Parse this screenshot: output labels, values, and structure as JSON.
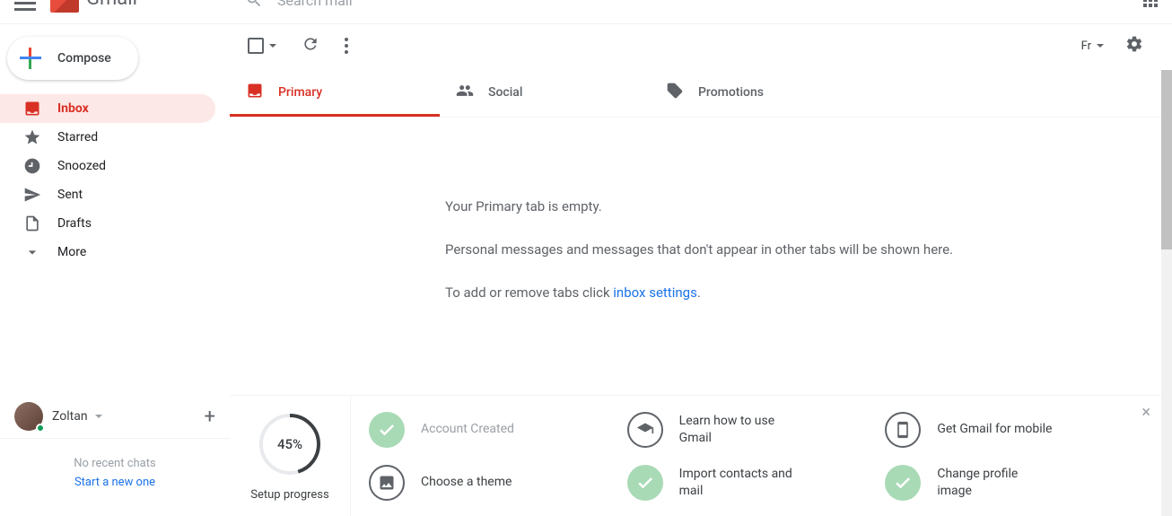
{
  "header": {
    "logo_text": "Gmail",
    "search_placeholder": "Search mail"
  },
  "sidebar": {
    "compose_label": "Compose",
    "items": [
      {
        "label": "Inbox",
        "icon": "inbox",
        "active": true
      },
      {
        "label": "Starred",
        "icon": "star"
      },
      {
        "label": "Snoozed",
        "icon": "clock"
      },
      {
        "label": "Sent",
        "icon": "send"
      },
      {
        "label": "Drafts",
        "icon": "file"
      },
      {
        "label": "More",
        "icon": "expand"
      }
    ]
  },
  "hangouts": {
    "user_name": "Zoltan",
    "no_chats": "No recent chats",
    "start_new": "Start a new one"
  },
  "toolbar": {
    "language": "Fr"
  },
  "tabs": [
    {
      "label": "Primary",
      "active": true
    },
    {
      "label": "Social"
    },
    {
      "label": "Promotions"
    }
  ],
  "empty": {
    "title": "Your Primary tab is empty.",
    "desc": "Personal messages and messages that don't appear in other tabs will be shown here.",
    "link_prefix": "To add or remove tabs click ",
    "link_text": "inbox settings",
    "link_suffix": "."
  },
  "setup": {
    "progress_percent": "45%",
    "progress_label": "Setup progress",
    "items": [
      {
        "label": "Account Created",
        "status": "done"
      },
      {
        "label": "Learn how to use Gmail",
        "status": "outlined",
        "icon": "grad"
      },
      {
        "label": "Get Gmail for mobile",
        "status": "outlined",
        "icon": "phone"
      },
      {
        "label": "Choose a theme",
        "status": "outlined",
        "icon": "image"
      },
      {
        "label": "Import contacts and mail",
        "status": "done"
      },
      {
        "label": "Change profile image",
        "status": "done"
      }
    ]
  }
}
